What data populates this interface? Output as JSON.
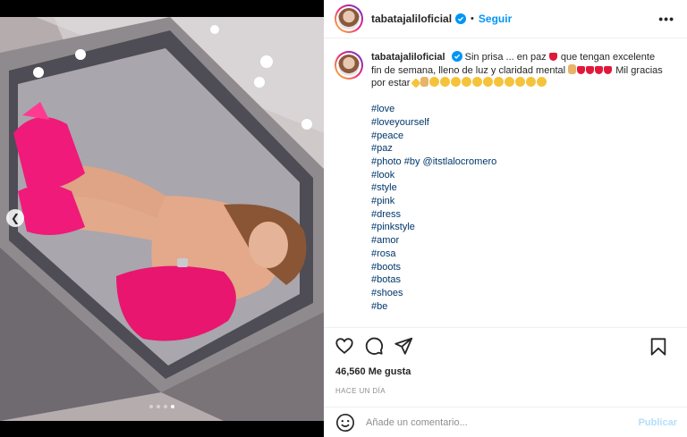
{
  "post": {
    "username": "tabatajalilоficial",
    "follow_label": "Seguir",
    "separator": "•",
    "more_label": "•••",
    "caption": {
      "username": "tabatajalilоficial",
      "part1": "Sin prisa ... en paz",
      "part2": "que tengan excelente fin de semana, lleno de luz y claridad mental",
      "part3": "Mil gracias por estar"
    },
    "hashtags": [
      "#love",
      "#loveyourself",
      "#peace",
      "#paz"
    ],
    "photo_credit": {
      "tag": "#photo",
      "by": "#by",
      "mention": "@itstlalocromero"
    },
    "hashtags2": [
      "#look",
      "#style",
      "#pink",
      "#dress",
      "#pinkstyle",
      "#amor",
      "#rosa",
      "#boots",
      "#botas",
      "#shoes",
      "#be"
    ],
    "likes": "46,560 Me gusta",
    "time": "HACE UN DÍA",
    "comment_placeholder": "Añade un comentario...",
    "publish_label": "Publicar"
  },
  "carousel": {
    "total": 4,
    "active_index": 3
  },
  "colors": {
    "accent": "#0095f6",
    "link": "#00376b",
    "publish_disabled": "#b2dffc",
    "dress": "#e8166f"
  },
  "icons": [
    "verified-badge",
    "heart-icon",
    "comment-icon",
    "share-icon",
    "bookmark-icon",
    "emoji-icon",
    "chevron-left-icon",
    "more-icon"
  ]
}
